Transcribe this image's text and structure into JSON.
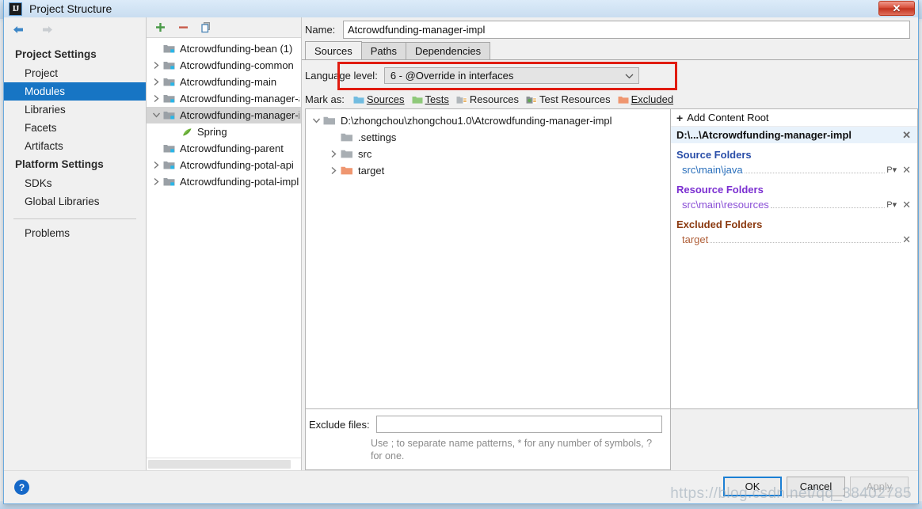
{
  "window": {
    "title": "Project Structure",
    "logo": "intellij-idea-logo",
    "close_label": "✕"
  },
  "sidebar": {
    "back_icon": "arrow-left-icon",
    "forward_icon": "arrow-right-icon",
    "groups": [
      {
        "label": "Project Settings",
        "items": [
          {
            "label": "Project",
            "selected": false
          },
          {
            "label": "Modules",
            "selected": true
          },
          {
            "label": "Libraries",
            "selected": false
          },
          {
            "label": "Facets",
            "selected": false
          },
          {
            "label": "Artifacts",
            "selected": false
          }
        ]
      },
      {
        "label": "Platform Settings",
        "items": [
          {
            "label": "SDKs",
            "selected": false
          },
          {
            "label": "Global Libraries",
            "selected": false
          }
        ]
      }
    ],
    "problems_label": "Problems"
  },
  "modules": {
    "toolbar": {
      "add_label": "+",
      "remove_label": "−",
      "copy_label": "copy-icon"
    },
    "tree": [
      {
        "label": "Atcrowdfunding-bean (1)",
        "twisty": "none",
        "icon": "module-icon",
        "indent": 0,
        "selected": false
      },
      {
        "label": "Atcrowdfunding-common",
        "twisty": "collapsed",
        "icon": "module-icon",
        "indent": 0,
        "selected": false
      },
      {
        "label": "Atcrowdfunding-main",
        "twisty": "collapsed",
        "icon": "module-icon",
        "indent": 0,
        "selected": false
      },
      {
        "label": "Atcrowdfunding-manager-a",
        "twisty": "collapsed",
        "icon": "module-icon",
        "indent": 0,
        "selected": false
      },
      {
        "label": "Atcrowdfunding-manager-i",
        "twisty": "expanded",
        "icon": "module-icon",
        "indent": 0,
        "selected": true
      },
      {
        "label": "Spring",
        "twisty": "none",
        "icon": "spring-leaf-icon",
        "indent": 1,
        "selected": false
      },
      {
        "label": "Atcrowdfunding-parent",
        "twisty": "none",
        "icon": "module-icon",
        "indent": 0,
        "selected": false
      },
      {
        "label": "Atcrowdfunding-potal-api",
        "twisty": "collapsed",
        "icon": "module-icon",
        "indent": 0,
        "selected": false
      },
      {
        "label": "Atcrowdfunding-potal-impl",
        "twisty": "collapsed",
        "icon": "module-icon",
        "indent": 0,
        "selected": false
      }
    ]
  },
  "editor": {
    "name_label": "Name:",
    "name_value": "Atcrowdfunding-manager-impl",
    "tabs": [
      {
        "label": "Sources",
        "active": true
      },
      {
        "label": "Paths",
        "active": false
      },
      {
        "label": "Dependencies",
        "active": false
      }
    ],
    "language_level": {
      "label": "Language level:",
      "value": "6 - @Override in interfaces",
      "chevron": "chevron-down-icon",
      "highlight_color": "#e01b10"
    },
    "mark_as": {
      "label": "Mark as:",
      "options": [
        {
          "label": "Sources",
          "icon": "folder-sources-icon",
          "color": "#72bce0"
        },
        {
          "label": "Tests",
          "icon": "folder-tests-icon",
          "color": "#8fc97a"
        },
        {
          "label": "Resources",
          "icon": "folder-resources-icon",
          "color": "#b0b6ba"
        },
        {
          "label": "Test Resources",
          "icon": "folder-test-resources-icon",
          "color": "#8a8f93"
        },
        {
          "label": "Excluded",
          "icon": "folder-excluded-icon",
          "color": "#ef9670"
        }
      ]
    },
    "content_tree": [
      {
        "label": "D:\\zhongchou\\zhongchou1.0\\Atcrowdfunding-manager-impl",
        "twisty": "expanded",
        "icon": "folder-gray-icon",
        "indent": 0
      },
      {
        "label": ".settings",
        "twisty": "none",
        "icon": "folder-gray-icon",
        "indent": 1
      },
      {
        "label": "src",
        "twisty": "collapsed",
        "icon": "folder-gray-icon",
        "indent": 1
      },
      {
        "label": "target",
        "twisty": "collapsed",
        "icon": "folder-orange-icon",
        "indent": 1
      }
    ],
    "exclude": {
      "label": "Exclude files:",
      "value": "",
      "placeholder": "",
      "hint": "Use ; to separate name patterns, * for any number of symbols, ? for one."
    }
  },
  "details": {
    "add_content_root": "Add Content Root",
    "add_icon": "plus-icon",
    "root_path": "D:\\...\\Atcrowdfunding-manager-impl",
    "root_remove_icon": "✕",
    "sections": [
      {
        "title": "Source Folders",
        "kind": "src",
        "color": "#2a4ea8",
        "folders": [
          {
            "path": "src\\main\\java",
            "package_prefix_icon": "P",
            "remove_icon": "✕"
          }
        ]
      },
      {
        "title": "Resource Folders",
        "kind": "res",
        "color": "#7b2fd1",
        "folders": [
          {
            "path": "src\\main\\resources",
            "package_prefix_icon": "P",
            "remove_icon": "✕"
          }
        ]
      },
      {
        "title": "Excluded Folders",
        "kind": "exc",
        "color": "#8b3a10",
        "folders": [
          {
            "path": "target",
            "package_prefix_icon": "",
            "remove_icon": "✕"
          }
        ]
      }
    ]
  },
  "footer": {
    "help_label": "?",
    "buttons": [
      {
        "label": "OK",
        "state": "default"
      },
      {
        "label": "Cancel",
        "state": "normal"
      },
      {
        "label": "Apply",
        "state": "disabled"
      }
    ],
    "watermark": "https://blog.csdn.net/qq_38402785"
  }
}
